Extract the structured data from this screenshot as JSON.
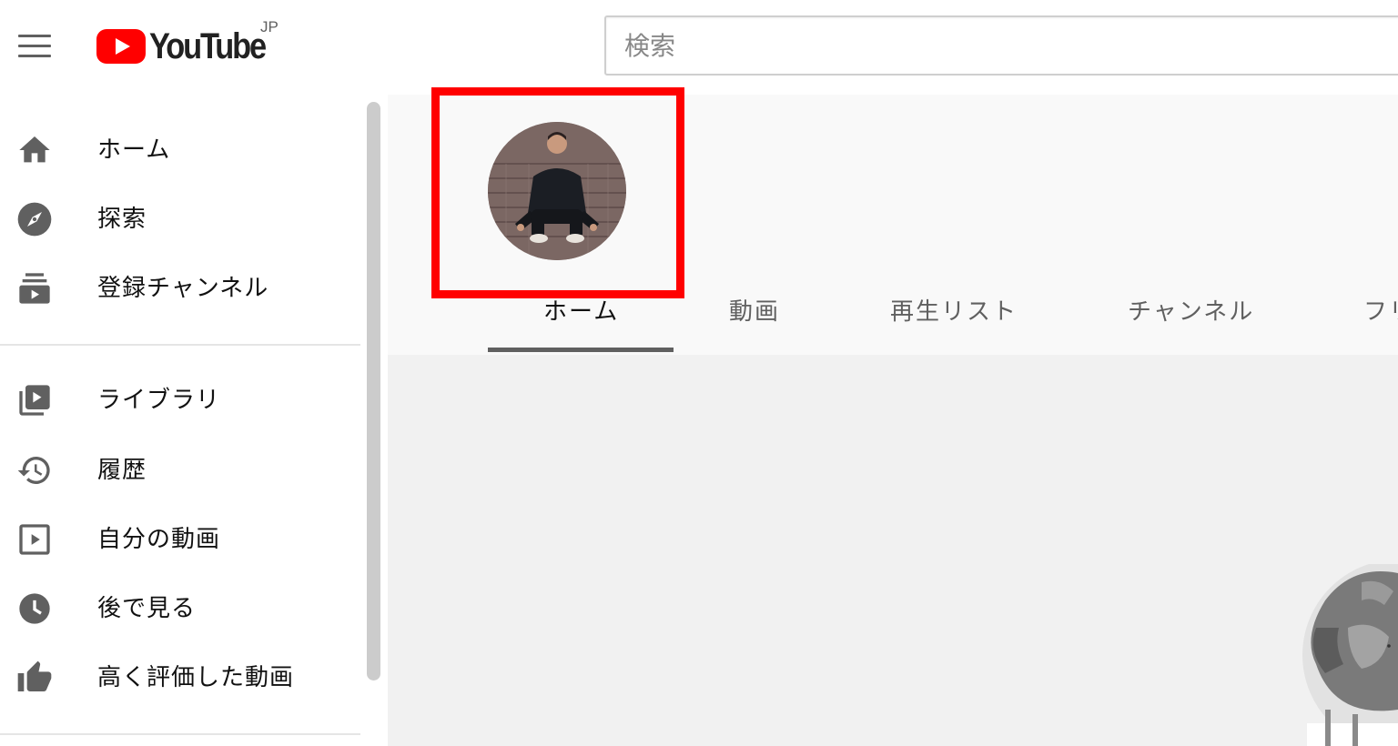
{
  "header": {
    "logo_text": "YouTube",
    "country_code": "JP",
    "search_placeholder": "検索",
    "brand_color": "#ff0000"
  },
  "sidebar": {
    "items": [
      {
        "label": "ホーム",
        "icon": "home-icon"
      },
      {
        "label": "探索",
        "icon": "explore-icon"
      },
      {
        "label": "登録チャンネル",
        "icon": "subscriptions-icon"
      },
      {
        "label": "ライブラリ",
        "icon": "library-icon"
      },
      {
        "label": "履歴",
        "icon": "history-icon"
      },
      {
        "label": "自分の動画",
        "icon": "my-videos-icon"
      },
      {
        "label": "後で見る",
        "icon": "watch-later-icon"
      },
      {
        "label": "高く評価した動画",
        "icon": "liked-videos-icon"
      }
    ]
  },
  "channel": {
    "tabs": [
      {
        "label": "ホーム",
        "active": true
      },
      {
        "label": "動画"
      },
      {
        "label": "再生リスト"
      },
      {
        "label": "チャンネル"
      },
      {
        "label": "フリ"
      }
    ],
    "highlight_color": "#ff0000"
  }
}
